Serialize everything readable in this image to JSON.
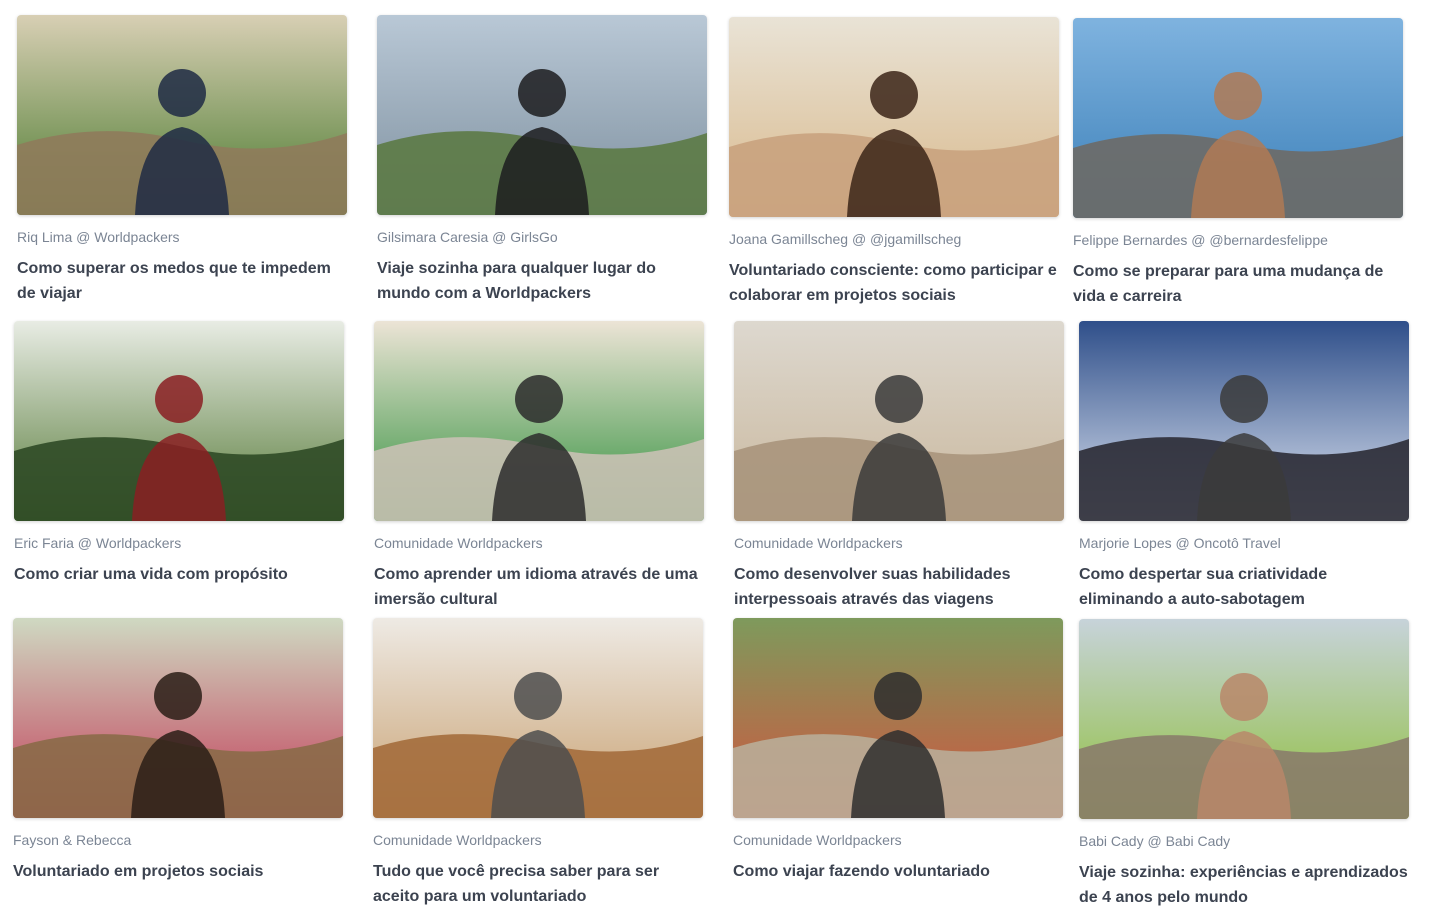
{
  "cards": [
    {
      "author": "Riq Lima @ Worldpackers",
      "title": "Como superar os medos que te impedem de viajar",
      "image": "man-under-straw-hut-with-sign",
      "colors": {
        "sky": "#d8cfb4",
        "ground": "#8f7b5b",
        "accent": "#4a7a2e",
        "person": "#1e2a44"
      }
    },
    {
      "author": "Gilsimara Caresia @ GirlsGo",
      "title": "Viaje sozinha para qualquer lugar do mundo com a Worldpackers",
      "image": "woman-sitting-on-mountain-view",
      "colors": {
        "sky": "#b9c8d6",
        "ground": "#5c7a45",
        "accent": "#7d8f9e",
        "person": "#1c1c1e"
      }
    },
    {
      "author": "Joana Gamillscheg @ @jgamillscheg",
      "title": "Voluntariado consciente: como participar e colaborar em projetos sociais",
      "image": "woman-and-child-touching-foreheads",
      "colors": {
        "sky": "#e9e3d6",
        "ground": "#c9a27e",
        "accent": "#d9b98c",
        "person": "#3b2418"
      }
    },
    {
      "author": "Felippe Bernardes @ @bernardesfelippe",
      "title": "Como se preparar para uma mudança de vida e carreira",
      "image": "man-selfie-on-coastal-road",
      "colors": {
        "sky": "#7fb3df",
        "ground": "#6d6a66",
        "accent": "#3b7fb8",
        "person": "#b07a55"
      }
    },
    {
      "author": "Eric Faria @ Worldpackers",
      "title": "Como criar uma vida com propósito",
      "image": "man-in-plaid-shirt-with-palm-trees",
      "colors": {
        "sky": "#e8ece4",
        "ground": "#2f4a26",
        "accent": "#567a38",
        "person": "#8a1f22"
      }
    },
    {
      "author": "Comunidade Worldpackers",
      "title": "Como aprender um idioma através de uma imersão cultural",
      "image": "friends-on-green-sofa",
      "colors": {
        "sky": "#ece4d6",
        "ground": "#c9c1b4",
        "accent": "#2f8f3a",
        "person": "#2b2b2b"
      }
    },
    {
      "author": "Comunidade Worldpackers",
      "title": "Como desenvolver suas habilidades interpessoais através das viagens",
      "image": "friends-laughing-on-stone-wall",
      "colors": {
        "sky": "#ddd8cf",
        "ground": "#a8957c",
        "accent": "#c9b79c",
        "person": "#3a3a3a"
      }
    },
    {
      "author": "Marjorie Lopes @ Oncotô Travel",
      "title": "Como despertar sua criatividade eliminando a auto-sabotagem",
      "image": "woman-in-front-of-ferris-wheel",
      "colors": {
        "sky": "#2f4f8a",
        "ground": "#2b2b35",
        "accent": "#dfe6f2",
        "person": "#3b3b3b"
      }
    },
    {
      "author": "Fayson & Rebecca",
      "title": "Voluntariado em projetos sociais",
      "image": "group-in-african-village",
      "colors": {
        "sky": "#cfd9c2",
        "ground": "#8a6a48",
        "accent": "#c23b57",
        "person": "#2a1d16"
      }
    },
    {
      "author": "Comunidade Worldpackers",
      "title": "Tudo que você precisa saber para ser aceito para um voluntariado",
      "image": "hostel-reception-with-flags",
      "colors": {
        "sky": "#eeeae4",
        "ground": "#a46d3c",
        "accent": "#c8a070",
        "person": "#4d4d4d"
      }
    },
    {
      "author": "Comunidade Worldpackers",
      "title": "Como viajar fazendo voluntariado",
      "image": "large-group-photo-outdoors",
      "colors": {
        "sky": "#7e9a5c",
        "ground": "#b9ad98",
        "accent": "#d2543f",
        "person": "#2e2e2e"
      }
    },
    {
      "author": "Babi Cady @ Babi Cady",
      "title": "Viaje sozinha: experiências e aprendizados de 4 anos pelo mundo",
      "image": "woman-on-beach-at-sunset",
      "colors": {
        "sky": "#c7d3da",
        "ground": "#8a7c6a",
        "accent": "#8fbf3a",
        "person": "#b8876a"
      }
    }
  ]
}
